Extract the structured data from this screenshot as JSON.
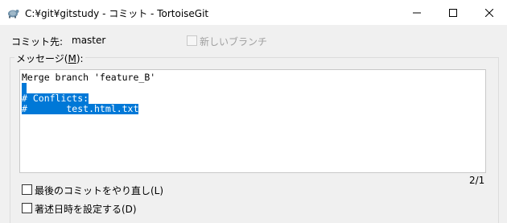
{
  "window": {
    "title": "C:¥git¥gitstudy - コミット - TortoiseGit",
    "minimize_glyph": "—",
    "maximize_glyph": "☐",
    "close_glyph": "✕"
  },
  "commit_to": {
    "label": "コミット先:",
    "branch": "master"
  },
  "new_branch": {
    "label": "新しいブランチ",
    "checked": false,
    "enabled": false
  },
  "message": {
    "label_prefix": "メッセージ(",
    "label_accel": "M",
    "label_suffix": "):",
    "lines": [
      "Merge branch 'feature_B'",
      "",
      "# Conflicts:",
      "#       test.html.txt"
    ]
  },
  "page_counter": "2/1",
  "options": [
    {
      "label": "最後のコミットをやり直し(L)",
      "checked": false
    },
    {
      "label": "著述日時を設定する(D)",
      "checked": false
    }
  ],
  "colors": {
    "selection": "#0078d7",
    "background": "#f0f0f0"
  },
  "icons": [
    "tortoisegit-app-icon",
    "minimize-icon",
    "maximize-icon",
    "close-icon"
  ]
}
